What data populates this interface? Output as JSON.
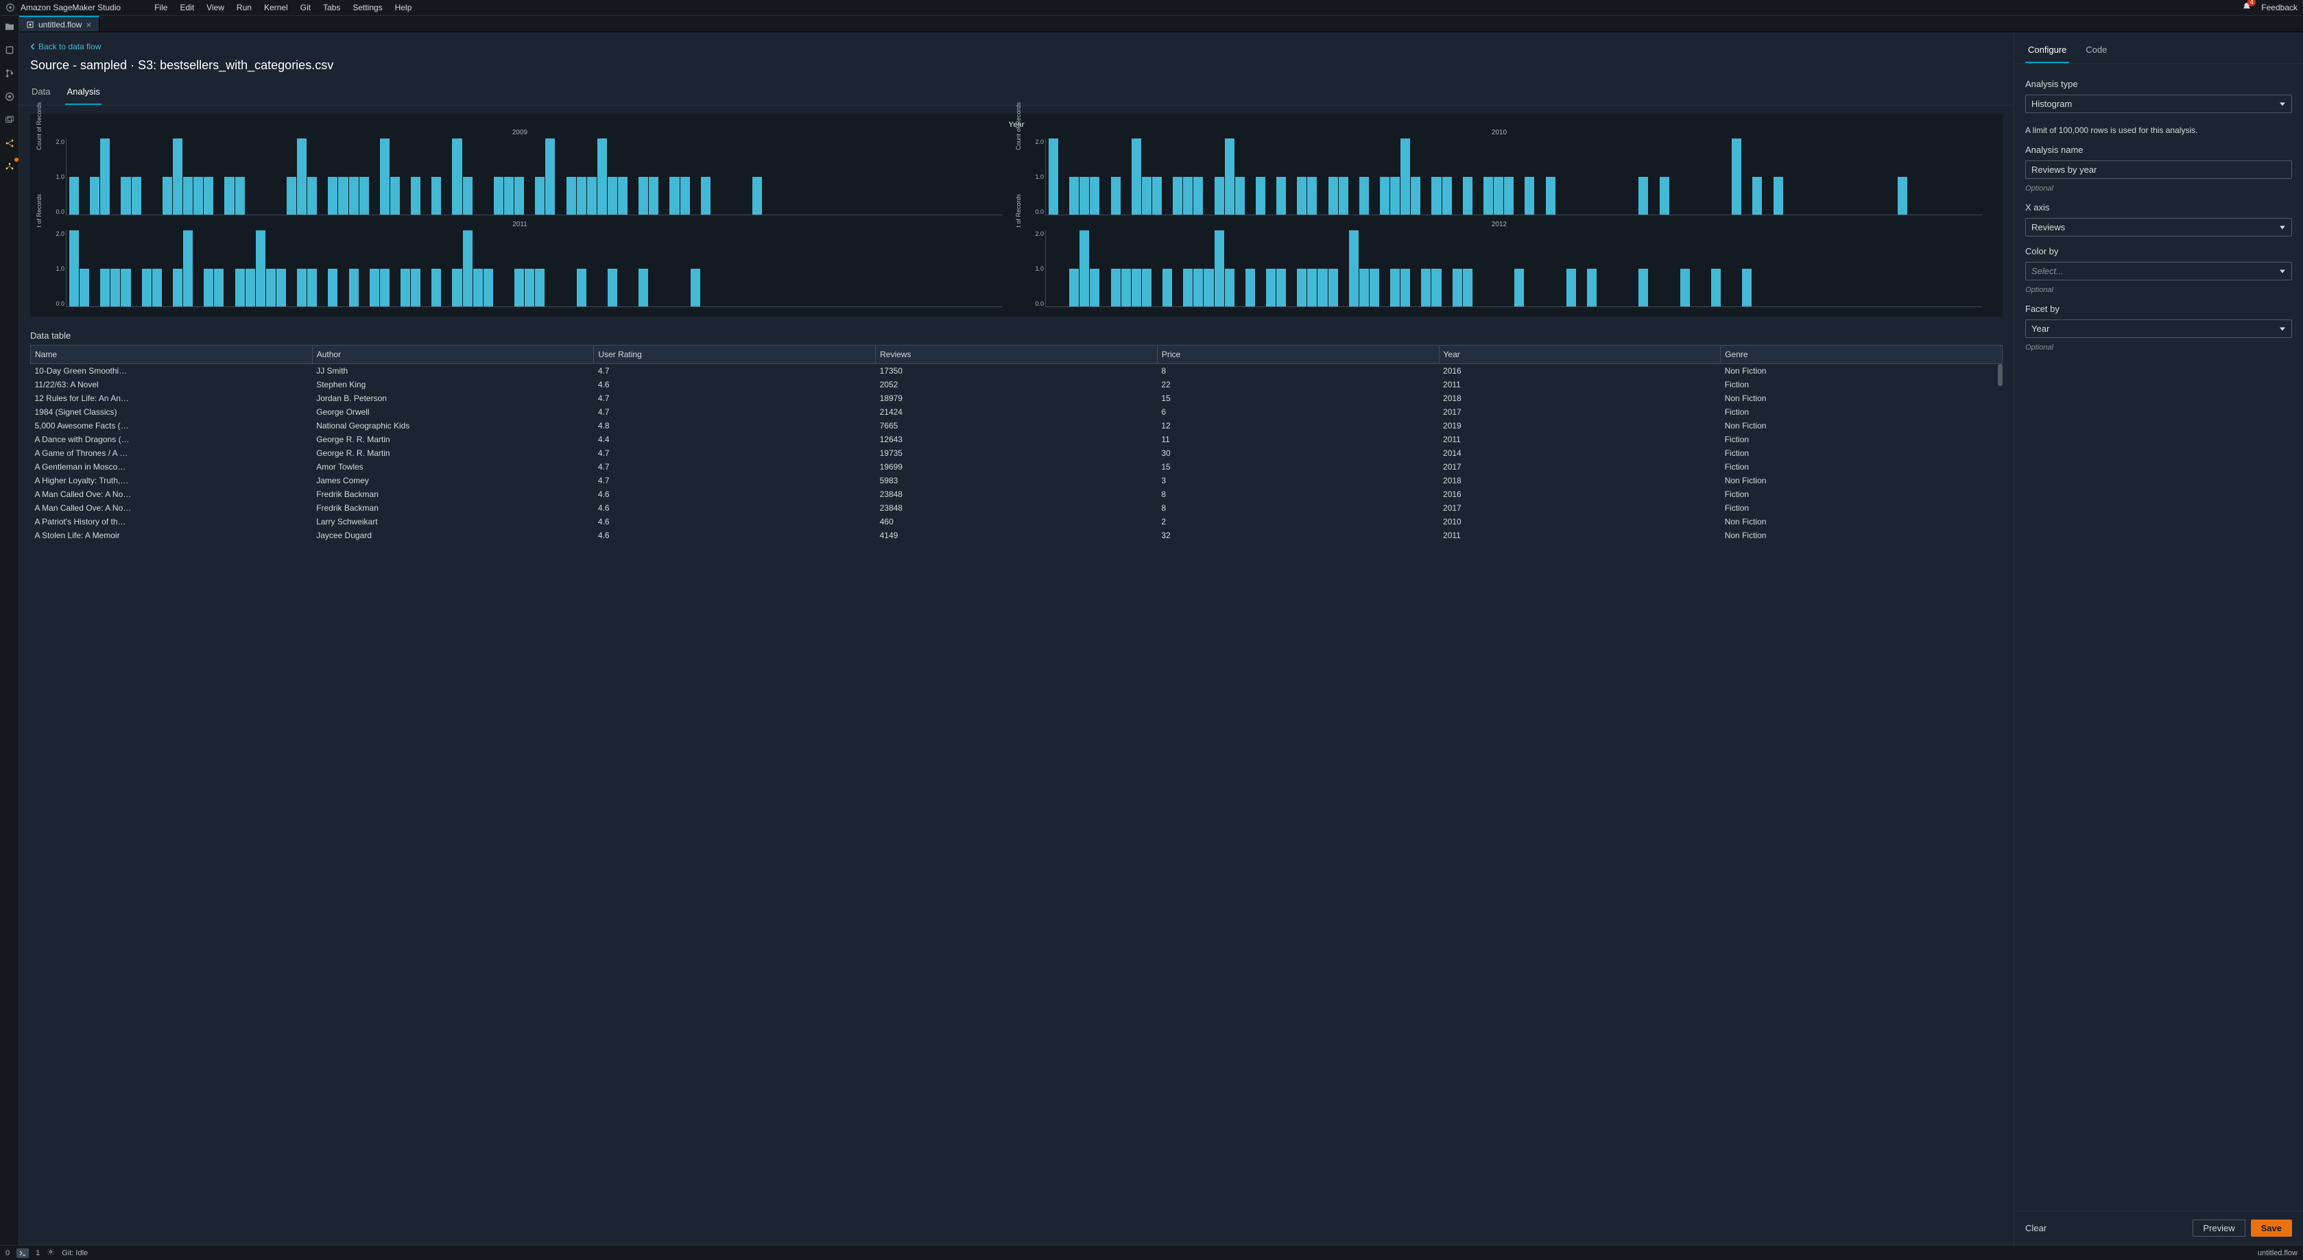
{
  "brand": "Amazon SageMaker Studio",
  "menu": [
    "File",
    "Edit",
    "View",
    "Run",
    "Kernel",
    "Git",
    "Tabs",
    "Settings",
    "Help"
  ],
  "notifications": {
    "count": "4"
  },
  "feedback_label": "Feedback",
  "file_tab": {
    "name": "untitled.flow"
  },
  "back_link": "Back to data flow",
  "page_title": "Source - sampled · S3: bestsellers_with_categories.csv",
  "inner_tabs": {
    "data": "Data",
    "analysis": "Analysis"
  },
  "chart_data": {
    "type": "bar",
    "title": "Year",
    "ylabel": "Count of Records",
    "ylim": [
      0.0,
      2.0
    ],
    "yticks": [
      "0.0",
      "1.0",
      "2.0"
    ],
    "facets": [
      {
        "year": "2009",
        "bars": [
          1,
          0,
          1,
          2,
          0,
          1,
          1,
          0,
          0,
          1,
          2,
          1,
          1,
          1,
          0,
          1,
          1,
          0,
          0,
          0,
          0,
          1,
          2,
          1,
          0,
          1,
          1,
          1,
          1,
          0,
          2,
          1,
          0,
          1,
          0,
          1,
          0,
          2,
          1,
          0,
          0,
          1,
          1,
          1,
          0,
          1,
          2,
          0,
          1,
          1,
          1,
          2,
          1,
          1,
          0,
          1,
          1,
          0,
          1,
          1,
          0,
          1,
          0,
          0,
          0,
          0,
          1,
          0,
          0,
          0,
          0,
          0,
          0,
          0,
          0,
          0,
          0,
          0,
          0,
          0,
          0,
          0,
          0,
          0,
          0,
          0,
          0,
          0,
          0,
          0
        ]
      },
      {
        "year": "2010",
        "bars": [
          2,
          0,
          1,
          1,
          1,
          0,
          1,
          0,
          2,
          1,
          1,
          0,
          1,
          1,
          1,
          0,
          1,
          2,
          1,
          0,
          1,
          0,
          1,
          0,
          1,
          1,
          0,
          1,
          1,
          0,
          1,
          0,
          1,
          1,
          2,
          1,
          0,
          1,
          1,
          0,
          1,
          0,
          1,
          1,
          1,
          0,
          1,
          0,
          1,
          0,
          0,
          0,
          0,
          0,
          0,
          0,
          0,
          1,
          0,
          1,
          0,
          0,
          0,
          0,
          0,
          0,
          2,
          0,
          1,
          0,
          1,
          0,
          0,
          0,
          0,
          0,
          0,
          0,
          0,
          0,
          0,
          0,
          1,
          0,
          0,
          0,
          0,
          0,
          0,
          0
        ]
      },
      {
        "year": "2011",
        "bars": [
          2,
          1,
          0,
          1,
          1,
          1,
          0,
          1,
          1,
          0,
          1,
          2,
          0,
          1,
          1,
          0,
          1,
          1,
          2,
          1,
          1,
          0,
          1,
          1,
          0,
          1,
          0,
          1,
          0,
          1,
          1,
          0,
          1,
          1,
          0,
          1,
          0,
          1,
          2,
          1,
          1,
          0,
          0,
          1,
          1,
          1,
          0,
          0,
          0,
          1,
          0,
          0,
          1,
          0,
          0,
          1,
          0,
          0,
          0,
          0,
          1,
          0,
          0,
          0,
          0,
          0,
          0,
          0,
          0,
          0,
          0,
          0,
          0,
          0,
          0,
          0,
          0,
          0,
          0,
          0,
          0,
          0,
          0,
          0,
          0,
          0,
          0,
          0,
          0,
          0
        ]
      },
      {
        "year": "2012",
        "bars": [
          0,
          0,
          1,
          2,
          1,
          0,
          1,
          1,
          1,
          1,
          0,
          1,
          0,
          1,
          1,
          1,
          2,
          1,
          0,
          1,
          0,
          1,
          1,
          0,
          1,
          1,
          1,
          1,
          0,
          2,
          1,
          1,
          0,
          1,
          1,
          0,
          1,
          1,
          0,
          1,
          1,
          0,
          0,
          0,
          0,
          1,
          0,
          0,
          0,
          0,
          1,
          0,
          1,
          0,
          0,
          0,
          0,
          1,
          0,
          0,
          0,
          1,
          0,
          0,
          1,
          0,
          0,
          1,
          0,
          0,
          0,
          0,
          0,
          0,
          0,
          0,
          0,
          0,
          0,
          0,
          0,
          0,
          0,
          0,
          0,
          0,
          0,
          0,
          0,
          0
        ]
      }
    ]
  },
  "table": {
    "label": "Data table",
    "headers": [
      "Name",
      "Author",
      "User Rating",
      "Reviews",
      "Price",
      "Year",
      "Genre"
    ],
    "rows": [
      [
        "10-Day Green Smoothi…",
        "JJ Smith",
        "4.7",
        "17350",
        "8",
        "2016",
        "Non Fiction"
      ],
      [
        "11/22/63: A Novel",
        "Stephen King",
        "4.6",
        "2052",
        "22",
        "2011",
        "Fiction"
      ],
      [
        "12 Rules for Life: An An…",
        "Jordan B. Peterson",
        "4.7",
        "18979",
        "15",
        "2018",
        "Non Fiction"
      ],
      [
        "1984 (Signet Classics)",
        "George Orwell",
        "4.7",
        "21424",
        "6",
        "2017",
        "Fiction"
      ],
      [
        "5,000 Awesome Facts (…",
        "National Geographic Kids",
        "4.8",
        "7665",
        "12",
        "2019",
        "Non Fiction"
      ],
      [
        "A Dance with Dragons (…",
        "George R. R. Martin",
        "4.4",
        "12643",
        "11",
        "2011",
        "Fiction"
      ],
      [
        "A Game of Thrones / A …",
        "George R. R. Martin",
        "4.7",
        "19735",
        "30",
        "2014",
        "Fiction"
      ],
      [
        "A Gentleman in Mosco…",
        "Amor Towles",
        "4.7",
        "19699",
        "15",
        "2017",
        "Fiction"
      ],
      [
        "A Higher Loyalty: Truth,…",
        "James Comey",
        "4.7",
        "5983",
        "3",
        "2018",
        "Non Fiction"
      ],
      [
        "A Man Called Ove: A No…",
        "Fredrik Backman",
        "4.6",
        "23848",
        "8",
        "2016",
        "Fiction"
      ],
      [
        "A Man Called Ove: A No…",
        "Fredrik Backman",
        "4.6",
        "23848",
        "8",
        "2017",
        "Fiction"
      ],
      [
        "A Patriot's History of th…",
        "Larry Schweikart",
        "4.6",
        "460",
        "2",
        "2010",
        "Non Fiction"
      ],
      [
        "A Stolen Life: A Memoir",
        "Jaycee Dugard",
        "4.6",
        "4149",
        "32",
        "2011",
        "Non Fiction"
      ]
    ]
  },
  "config": {
    "tabs": {
      "configure": "Configure",
      "code": "Code"
    },
    "analysis_type": {
      "label": "Analysis type",
      "value": "Histogram"
    },
    "limit_note": "A limit of 100,000 rows is used for this analysis.",
    "analysis_name": {
      "label": "Analysis name",
      "value": "Reviews by year",
      "hint": "Optional"
    },
    "x_axis": {
      "label": "X axis",
      "value": "Reviews"
    },
    "color_by": {
      "label": "Color by",
      "placeholder": "Select...",
      "hint": "Optional"
    },
    "facet_by": {
      "label": "Facet by",
      "value": "Year",
      "hint": "Optional"
    },
    "footer": {
      "clear": "Clear",
      "preview": "Preview",
      "save": "Save"
    }
  },
  "status": {
    "left_a": "0",
    "left_b": "1",
    "git": "Git: Idle",
    "right": "untitled.flow"
  }
}
